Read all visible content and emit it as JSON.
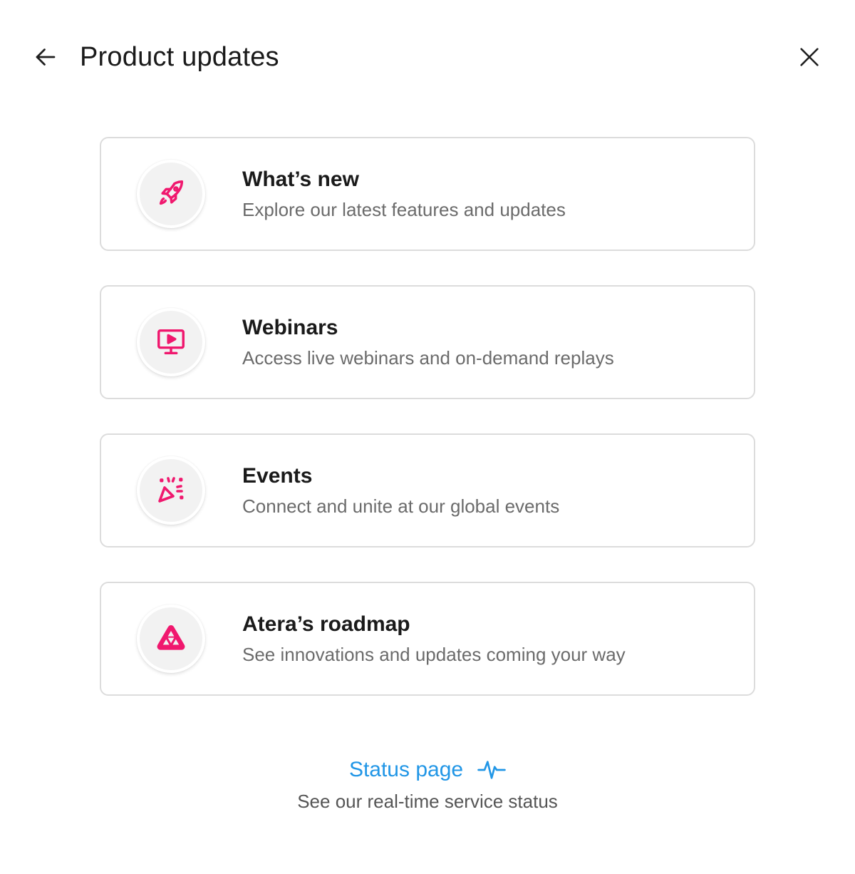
{
  "header": {
    "title": "Product updates",
    "back_icon": "arrow-left-icon",
    "close_icon": "close-icon"
  },
  "cards": [
    {
      "title": "What’s new",
      "description": "Explore our latest features and updates",
      "icon": "rocket-icon"
    },
    {
      "title": "Webinars",
      "description": "Access live webinars and on-demand replays",
      "icon": "monitor-play-icon"
    },
    {
      "title": "Events",
      "description": "Connect and unite at our global events",
      "icon": "party-popper-icon"
    },
    {
      "title": "Atera’s roadmap",
      "description": "See innovations and updates coming your way",
      "icon": "atera-logo-icon"
    }
  ],
  "status": {
    "link_label": "Status page",
    "description": "See our real-time service status",
    "icon": "pulse-icon"
  },
  "colors": {
    "accent_pink": "#f0186e",
    "link_blue": "#2196e6",
    "icon_bg": "#f2f2f2",
    "card_border": "#dcdcdc"
  }
}
